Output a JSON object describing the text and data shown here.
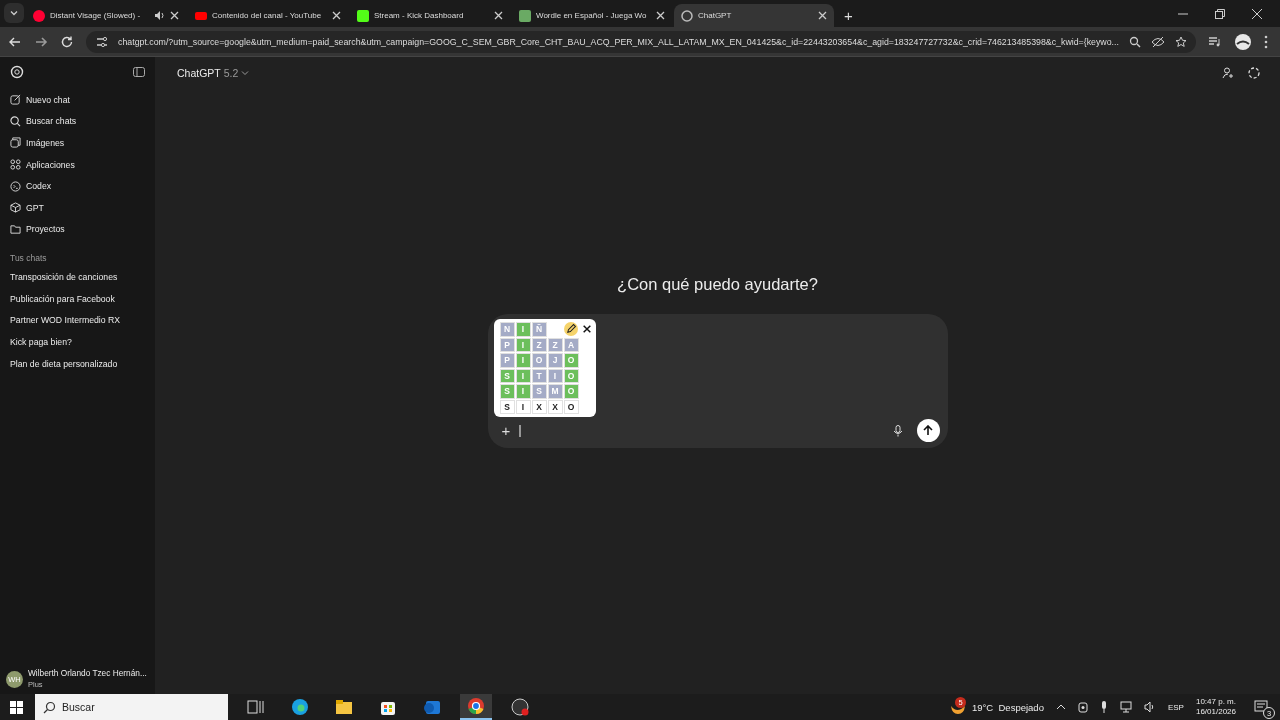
{
  "browser": {
    "tabs": [
      {
        "title": "Distant Visage (Slowed) -",
        "audio": true,
        "selected": false
      },
      {
        "title": "Contenido del canal - YouTube",
        "audio": false,
        "selected": false
      },
      {
        "title": "Stream - Kick Dashboard",
        "audio": false,
        "selected": false
      },
      {
        "title": "Wordle en Español - Juega Wo",
        "audio": false,
        "selected": false
      },
      {
        "title": "ChatGPT",
        "audio": false,
        "selected": true
      }
    ],
    "new_tab": "+",
    "url": "chatgpt.com/?utm_source=google&utm_medium=paid_search&utm_campaign=GOOG_C_SEM_GBR_Core_CHT_BAU_ACQ_PER_MIX_ALL_LATAM_MX_EN_041425&c_id=22443203654&c_agid=183247727732&c_crid=746213485398&c_kwid={keywo..."
  },
  "sidebar": {
    "nav": [
      "Nuevo chat",
      "Buscar chats",
      "Imágenes",
      "Aplicaciones",
      "Codex",
      "GPT",
      "Proyectos"
    ],
    "section_title": "Tus chats",
    "chats": [
      "Transposición de canciones",
      "Publicación para Facebook",
      "Partner WOD Intermedio RX",
      "Kick paga bien?",
      "Plan de dieta personalizado"
    ],
    "user": {
      "initials": "WH",
      "name": "Wilberth Orlando Tzec Hernán...",
      "plan": "Plus"
    }
  },
  "header": {
    "model": "ChatGPT",
    "version": "5.2"
  },
  "greeting": "¿Con qué puedo ayudarte?",
  "composer": {
    "attachment": {
      "rows": [
        [
          {
            "letter": "N",
            "color": "#a4abc6"
          },
          {
            "letter": "I",
            "color": "#6cbf5c"
          },
          {
            "letter": "Ñ",
            "color": "#a4abc6"
          }
        ],
        [
          {
            "letter": "P",
            "color": "#a4abc6"
          },
          {
            "letter": "I",
            "color": "#6cbf5c"
          },
          {
            "letter": "Z",
            "color": "#a4abc6"
          },
          {
            "letter": "Z",
            "color": "#a4abc6"
          },
          {
            "letter": "A",
            "color": "#a4abc6"
          }
        ],
        [
          {
            "letter": "P",
            "color": "#a4abc6"
          },
          {
            "letter": "I",
            "color": "#6cbf5c"
          },
          {
            "letter": "O",
            "color": "#a4abc6"
          },
          {
            "letter": "J",
            "color": "#a4abc6"
          },
          {
            "letter": "O",
            "color": "#6cbf5c"
          }
        ],
        [
          {
            "letter": "S",
            "color": "#6cbf5c"
          },
          {
            "letter": "I",
            "color": "#6cbf5c"
          },
          {
            "letter": "T",
            "color": "#a4abc6"
          },
          {
            "letter": "I",
            "color": "#a4abc6"
          },
          {
            "letter": "O",
            "color": "#6cbf5c"
          }
        ],
        [
          {
            "letter": "S",
            "color": "#6cbf5c"
          },
          {
            "letter": "I",
            "color": "#6cbf5c"
          },
          {
            "letter": "S",
            "color": "#a4abc6"
          },
          {
            "letter": "M",
            "color": "#a4abc6"
          },
          {
            "letter": "O",
            "color": "#6cbf5c"
          }
        ],
        [
          {
            "letter": "S",
            "color": "#ffffff"
          },
          {
            "letter": "I",
            "color": "#ffffff"
          },
          {
            "letter": "X",
            "color": "#ffffff"
          },
          {
            "letter": "X",
            "color": "#ffffff"
          },
          {
            "letter": "O",
            "color": "#ffffff"
          }
        ]
      ]
    },
    "plus": "+"
  },
  "taskbar": {
    "search_placeholder": "Buscar",
    "apps": [
      {
        "selected": false
      },
      {
        "selected": false
      },
      {
        "selected": false
      },
      {
        "selected": false
      },
      {
        "selected": false
      },
      {
        "selected": true
      },
      {
        "selected": false
      }
    ],
    "weather": {
      "badge": "5",
      "text": "19°C  Despejado"
    },
    "language": "ESP",
    "time": "10:47 p. m.",
    "date": "16/01/2026",
    "notifications": "3"
  }
}
